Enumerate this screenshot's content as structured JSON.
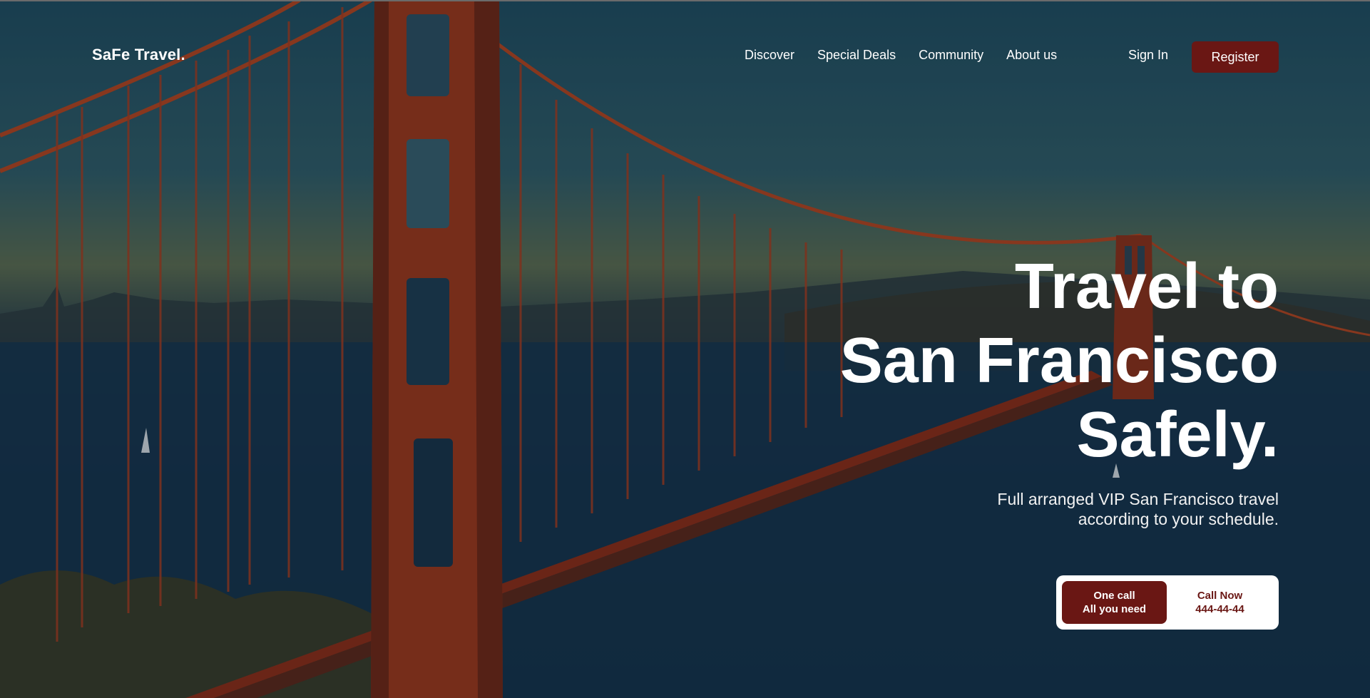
{
  "brand": {
    "logo_text": "SaFe Travel."
  },
  "nav": {
    "items": [
      {
        "label": "Discover"
      },
      {
        "label": "Special Deals"
      },
      {
        "label": "Community"
      },
      {
        "label": "About us"
      }
    ],
    "sign_in_label": "Sign In",
    "register_label": "Register"
  },
  "hero": {
    "headline_lines": [
      "Travel to",
      "San Francisco",
      "Safely."
    ],
    "subtitle_lines": [
      "Full arranged VIP San Francisco travel",
      "according to your schedule."
    ],
    "cta": {
      "primary_line1": "One call",
      "primary_line2": "All you need",
      "secondary_line1": "Call Now",
      "secondary_line2": "444-44-44"
    }
  },
  "colors": {
    "accent": "#6a1714",
    "text": "#ffffff"
  }
}
